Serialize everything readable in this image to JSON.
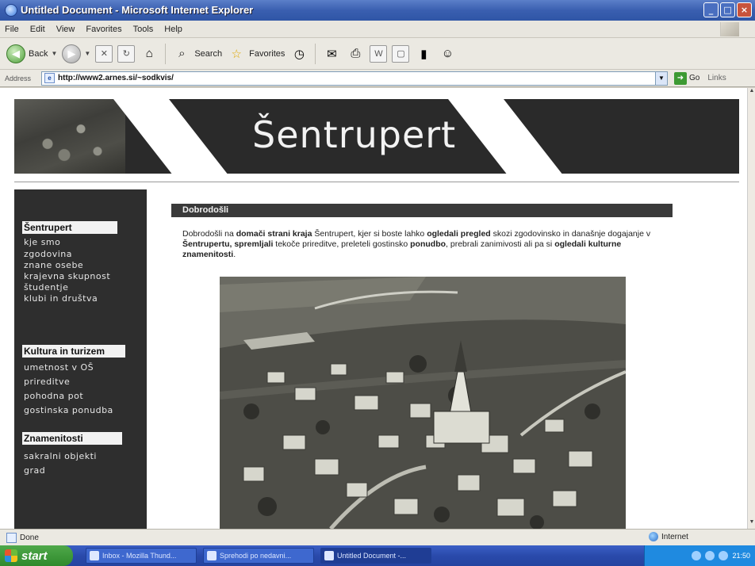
{
  "window": {
    "title": "Untitled Document - Microsoft Internet Explorer",
    "controls": [
      "_",
      "□",
      "×"
    ]
  },
  "menu": [
    "File",
    "Edit",
    "View",
    "Favorites",
    "Tools",
    "Help"
  ],
  "toolbar": {
    "back_label": "Back",
    "search_label": "Search",
    "favorites_label": "Favorites"
  },
  "address": {
    "label": "Address",
    "url": "http://www2.arnes.si/~sodkvis/",
    "go_label": "Go",
    "links_label": "Links"
  },
  "banner": {
    "title": "Šentrupert"
  },
  "sidebar": {
    "groups": [
      {
        "heading": "Šentrupert",
        "items": [
          "kje smo",
          "zgodovina",
          "znane osebe",
          "krajevna skupnost",
          "študentje",
          "klubi in društva"
        ]
      },
      {
        "heading": "Kultura in turizem",
        "items": [
          "umetnost v OŠ",
          "prireditve",
          "pohodna pot",
          "gostinska ponudba"
        ]
      },
      {
        "heading": "Znamenitosti",
        "items": [
          "sakralni objekti",
          "grad"
        ]
      }
    ]
  },
  "main": {
    "section_title": "Dobrodošli",
    "intro": {
      "p1": "Dobrodošli na ",
      "b1": "domači strani kraja",
      "p2": " Šentrupert, kjer si boste lahko ",
      "b2": "ogledali pregled",
      "p3": " skozi zgodovinsko in današnje dogajanje v ",
      "b3": "Šentrupertu, spremljali",
      "p4": " tekoče prireditve, preleteli gostinsko ",
      "b4": "ponudbo",
      "p5": ", prebrali zanimivosti ali pa si ",
      "b5": "ogledali kulturne znamenitosti",
      "p6": "."
    }
  },
  "status": {
    "text": "Done",
    "zone": "Internet"
  },
  "taskbar": {
    "start_label": "start",
    "tasks": [
      "Inbox - Mozilla Thund...",
      "Sprehodi po nedavni...",
      "Untitled Document -..."
    ],
    "clock": "21:50"
  },
  "colors": {
    "titlebar": "#3a5fb0",
    "sidebar_bg": "#2e2e2e",
    "section_bar": "#3a3a3a",
    "taskbar": "#2a4aab",
    "start_button": "#2f8a2c"
  }
}
